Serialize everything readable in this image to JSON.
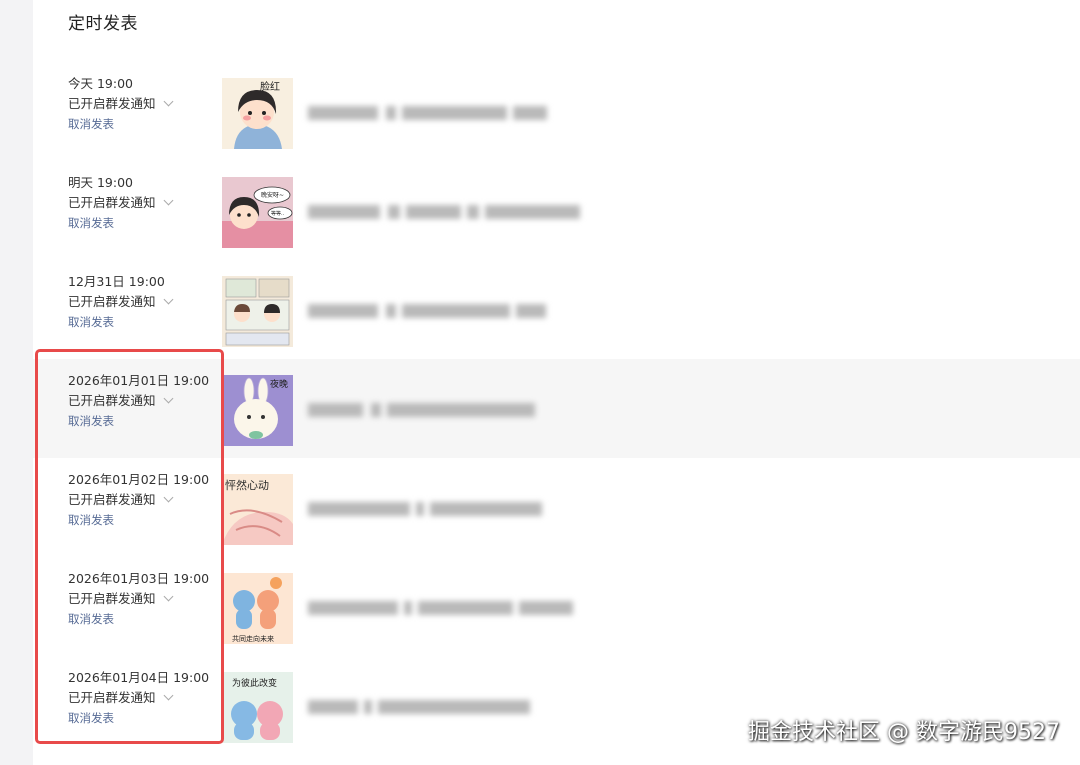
{
  "page": {
    "title": "定时发表"
  },
  "posts": [
    {
      "time": "今天 19:00",
      "notify": "已开启群发通知",
      "cancel": "取消发表",
      "thumb_text": "脸红"
    },
    {
      "time": "明天 19:00",
      "notify": "已开启群发通知",
      "cancel": "取消发表",
      "thumb_text": "晚安呀~",
      "thumb_text2": "等等.."
    },
    {
      "time": "12月31日 19:00",
      "notify": "已开启群发通知",
      "cancel": "取消发表",
      "thumb_text": ""
    },
    {
      "time": "2026年01月01日 19:00",
      "notify": "已开启群发通知",
      "cancel": "取消发表",
      "thumb_text": "夜晚"
    },
    {
      "time": "2026年01月02日 19:00",
      "notify": "已开启群发通知",
      "cancel": "取消发表",
      "thumb_text": "怦然心动"
    },
    {
      "time": "2026年01月03日 19:00",
      "notify": "已开启群发通知",
      "cancel": "取消发表",
      "thumb_text": "共同走向未来"
    },
    {
      "time": "2026年01月04日 19:00",
      "notify": "已开启群发通知",
      "cancel": "取消发表",
      "thumb_text": "为彼此改变"
    }
  ],
  "watermark": "掘金技术社区 @ 数字游民9527",
  "colors": {
    "link": "#576b95",
    "highlight": "#e84a4a",
    "row_hover": "#f6f6f6"
  }
}
